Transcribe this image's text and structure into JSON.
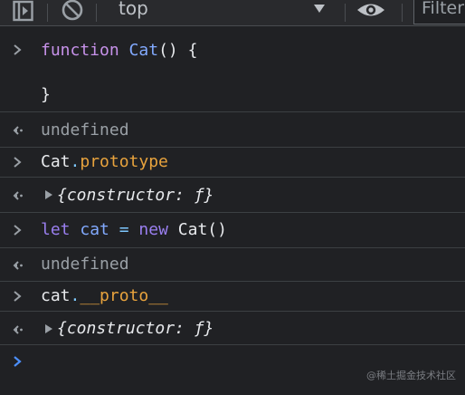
{
  "toolbar": {
    "context": "top",
    "filter_placeholder": "Filter",
    "icons": [
      "sidebar-icon",
      "clear-console-icon",
      "dropdown-caret-icon",
      "eye-icon"
    ]
  },
  "console": {
    "entries": [
      {
        "kind": "input",
        "tokens": [
          {
            "t": "function",
            "c": "kw"
          },
          {
            "t": " "
          },
          {
            "t": "Cat",
            "c": "fn"
          },
          {
            "t": "() {"
          }
        ],
        "line2": "}"
      },
      {
        "kind": "output",
        "text": "undefined"
      },
      {
        "kind": "input",
        "tokens": [
          {
            "t": "Cat"
          },
          {
            "t": ".",
            "c": "op"
          },
          {
            "t": "prototype",
            "c": "prop"
          }
        ]
      },
      {
        "kind": "output",
        "text": "{constructor: ƒ}"
      },
      {
        "kind": "input",
        "tokens": [
          {
            "t": "let",
            "c": "kw2"
          },
          {
            "t": " "
          },
          {
            "t": "cat",
            "c": "fn"
          },
          {
            "t": " "
          },
          {
            "t": "=",
            "c": "op"
          },
          {
            "t": " "
          },
          {
            "t": "new",
            "c": "kw2"
          },
          {
            "t": " "
          },
          {
            "t": "Cat()"
          }
        ]
      },
      {
        "kind": "output",
        "text": "undefined"
      },
      {
        "kind": "input",
        "tokens": [
          {
            "t": "cat"
          },
          {
            "t": ".",
            "c": "op"
          },
          {
            "t": "__proto__",
            "c": "prop"
          }
        ]
      },
      {
        "kind": "output",
        "text": "{constructor: ƒ}"
      }
    ]
  },
  "watermark": "@稀土掘金技术社区",
  "colors": {
    "background": "#202124",
    "toolbar": "#292a2d",
    "keyword": "#c792ea",
    "function_name": "#82aaff",
    "property": "#e8a33d",
    "prompt_active": "#4c8ffb"
  }
}
